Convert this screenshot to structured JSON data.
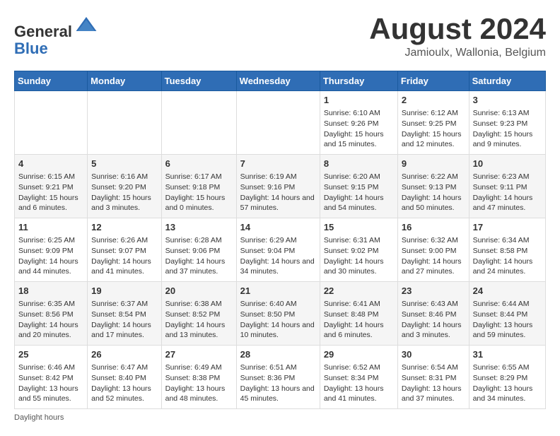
{
  "header": {
    "logo_line1": "General",
    "logo_line2": "Blue",
    "month_title": "August 2024",
    "location": "Jamioulx, Wallonia, Belgium"
  },
  "days_of_week": [
    "Sunday",
    "Monday",
    "Tuesday",
    "Wednesday",
    "Thursday",
    "Friday",
    "Saturday"
  ],
  "weeks": [
    [
      {
        "day": "",
        "info": ""
      },
      {
        "day": "",
        "info": ""
      },
      {
        "day": "",
        "info": ""
      },
      {
        "day": "",
        "info": ""
      },
      {
        "day": "1",
        "info": "Sunrise: 6:10 AM\nSunset: 9:26 PM\nDaylight: 15 hours and 15 minutes."
      },
      {
        "day": "2",
        "info": "Sunrise: 6:12 AM\nSunset: 9:25 PM\nDaylight: 15 hours and 12 minutes."
      },
      {
        "day": "3",
        "info": "Sunrise: 6:13 AM\nSunset: 9:23 PM\nDaylight: 15 hours and 9 minutes."
      }
    ],
    [
      {
        "day": "4",
        "info": "Sunrise: 6:15 AM\nSunset: 9:21 PM\nDaylight: 15 hours and 6 minutes."
      },
      {
        "day": "5",
        "info": "Sunrise: 6:16 AM\nSunset: 9:20 PM\nDaylight: 15 hours and 3 minutes."
      },
      {
        "day": "6",
        "info": "Sunrise: 6:17 AM\nSunset: 9:18 PM\nDaylight: 15 hours and 0 minutes."
      },
      {
        "day": "7",
        "info": "Sunrise: 6:19 AM\nSunset: 9:16 PM\nDaylight: 14 hours and 57 minutes."
      },
      {
        "day": "8",
        "info": "Sunrise: 6:20 AM\nSunset: 9:15 PM\nDaylight: 14 hours and 54 minutes."
      },
      {
        "day": "9",
        "info": "Sunrise: 6:22 AM\nSunset: 9:13 PM\nDaylight: 14 hours and 50 minutes."
      },
      {
        "day": "10",
        "info": "Sunrise: 6:23 AM\nSunset: 9:11 PM\nDaylight: 14 hours and 47 minutes."
      }
    ],
    [
      {
        "day": "11",
        "info": "Sunrise: 6:25 AM\nSunset: 9:09 PM\nDaylight: 14 hours and 44 minutes."
      },
      {
        "day": "12",
        "info": "Sunrise: 6:26 AM\nSunset: 9:07 PM\nDaylight: 14 hours and 41 minutes."
      },
      {
        "day": "13",
        "info": "Sunrise: 6:28 AM\nSunset: 9:06 PM\nDaylight: 14 hours and 37 minutes."
      },
      {
        "day": "14",
        "info": "Sunrise: 6:29 AM\nSunset: 9:04 PM\nDaylight: 14 hours and 34 minutes."
      },
      {
        "day": "15",
        "info": "Sunrise: 6:31 AM\nSunset: 9:02 PM\nDaylight: 14 hours and 30 minutes."
      },
      {
        "day": "16",
        "info": "Sunrise: 6:32 AM\nSunset: 9:00 PM\nDaylight: 14 hours and 27 minutes."
      },
      {
        "day": "17",
        "info": "Sunrise: 6:34 AM\nSunset: 8:58 PM\nDaylight: 14 hours and 24 minutes."
      }
    ],
    [
      {
        "day": "18",
        "info": "Sunrise: 6:35 AM\nSunset: 8:56 PM\nDaylight: 14 hours and 20 minutes."
      },
      {
        "day": "19",
        "info": "Sunrise: 6:37 AM\nSunset: 8:54 PM\nDaylight: 14 hours and 17 minutes."
      },
      {
        "day": "20",
        "info": "Sunrise: 6:38 AM\nSunset: 8:52 PM\nDaylight: 14 hours and 13 minutes."
      },
      {
        "day": "21",
        "info": "Sunrise: 6:40 AM\nSunset: 8:50 PM\nDaylight: 14 hours and 10 minutes."
      },
      {
        "day": "22",
        "info": "Sunrise: 6:41 AM\nSunset: 8:48 PM\nDaylight: 14 hours and 6 minutes."
      },
      {
        "day": "23",
        "info": "Sunrise: 6:43 AM\nSunset: 8:46 PM\nDaylight: 14 hours and 3 minutes."
      },
      {
        "day": "24",
        "info": "Sunrise: 6:44 AM\nSunset: 8:44 PM\nDaylight: 13 hours and 59 minutes."
      }
    ],
    [
      {
        "day": "25",
        "info": "Sunrise: 6:46 AM\nSunset: 8:42 PM\nDaylight: 13 hours and 55 minutes."
      },
      {
        "day": "26",
        "info": "Sunrise: 6:47 AM\nSunset: 8:40 PM\nDaylight: 13 hours and 52 minutes."
      },
      {
        "day": "27",
        "info": "Sunrise: 6:49 AM\nSunset: 8:38 PM\nDaylight: 13 hours and 48 minutes."
      },
      {
        "day": "28",
        "info": "Sunrise: 6:51 AM\nSunset: 8:36 PM\nDaylight: 13 hours and 45 minutes."
      },
      {
        "day": "29",
        "info": "Sunrise: 6:52 AM\nSunset: 8:34 PM\nDaylight: 13 hours and 41 minutes."
      },
      {
        "day": "30",
        "info": "Sunrise: 6:54 AM\nSunset: 8:31 PM\nDaylight: 13 hours and 37 minutes."
      },
      {
        "day": "31",
        "info": "Sunrise: 6:55 AM\nSunset: 8:29 PM\nDaylight: 13 hours and 34 minutes."
      }
    ]
  ],
  "footer": {
    "daylight_label": "Daylight hours"
  }
}
